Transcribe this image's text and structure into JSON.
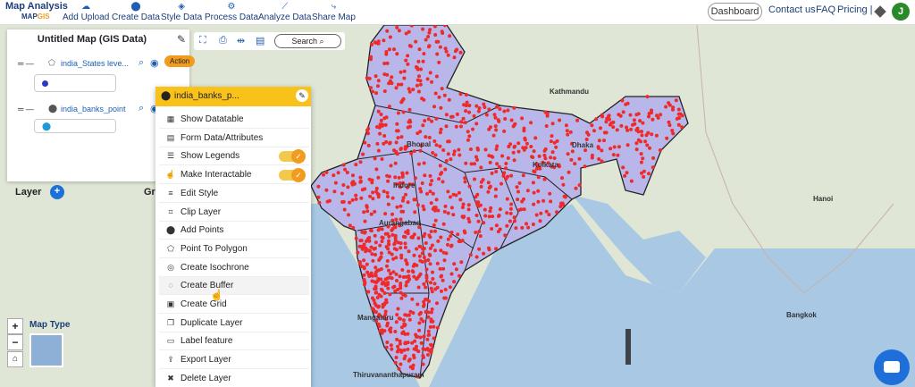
{
  "nav": {
    "logo_line1": "Map Analysis",
    "logo_map": "MAP",
    "logo_gis": "GIS",
    "items": [
      {
        "label": "Add Upload",
        "icon": "cloud-upload-icon"
      },
      {
        "label": "Create Data",
        "icon": "location-pin-icon"
      },
      {
        "label": "Style Data",
        "icon": "paint-bucket-icon"
      },
      {
        "label": "Process Data",
        "icon": "process-icon"
      },
      {
        "label": "Analyze Data",
        "icon": "analyze-icon"
      },
      {
        "label": "Share Map",
        "icon": "share-icon"
      }
    ],
    "dashboard": "Dashboard",
    "contact": "Contact us",
    "faq": "FAQ",
    "pricing": "Pricing |",
    "avatar_initial": "J"
  },
  "panel": {
    "title": "Untitled Map (GIS Data)",
    "layers": [
      {
        "name": "india_States leve...",
        "action": "Action"
      },
      {
        "name": "india_banks_point"
      }
    ],
    "layer_label": "Layer",
    "group_label": "Grou"
  },
  "tools": {
    "search_label": "Search"
  },
  "context_menu": {
    "title": "india_banks_p...",
    "items": [
      {
        "label": "Show Datatable",
        "icon": "table-icon"
      },
      {
        "label": "Form Data/Attributes",
        "icon": "form-icon"
      },
      {
        "label": "Show Legends",
        "icon": "list-icon",
        "toggle": true
      },
      {
        "label": "Make Interactable",
        "icon": "hand-icon",
        "toggle": true
      },
      {
        "label": "Edit Style",
        "icon": "edit-style-icon"
      },
      {
        "label": "Clip Layer",
        "icon": "crop-icon"
      },
      {
        "label": "Add Points",
        "icon": "pin-icon"
      },
      {
        "label": "Point To Polygon",
        "icon": "polygon-icon"
      },
      {
        "label": "Create Isochrone",
        "icon": "isochrone-icon"
      },
      {
        "label": "Create Buffer",
        "icon": "buffer-icon"
      },
      {
        "label": "Create Grid",
        "icon": "grid-icon"
      },
      {
        "label": "Duplicate Layer",
        "icon": "duplicate-icon"
      },
      {
        "label": "Label feature",
        "icon": "label-icon"
      },
      {
        "label": "Export Layer",
        "icon": "export-icon"
      },
      {
        "label": "Delete Layer",
        "icon": "trash-icon"
      }
    ]
  },
  "map": {
    "map_type_label": "Map Type",
    "cities": [
      "Bhopal",
      "Indore",
      "Aurangabad",
      "Mangaluru",
      "Thiruvananthapuram",
      "Kathmandu",
      "Hanoi",
      "Bangkok",
      "Dhaka",
      "Kolkata"
    ],
    "colors": {
      "polygon": "#b9b7ea",
      "points": "#ee2a2a",
      "accent": "#f29c1f",
      "header": "#f8c21b"
    }
  },
  "zoom": {
    "in": "+",
    "out": "−",
    "reset": "⌂"
  }
}
